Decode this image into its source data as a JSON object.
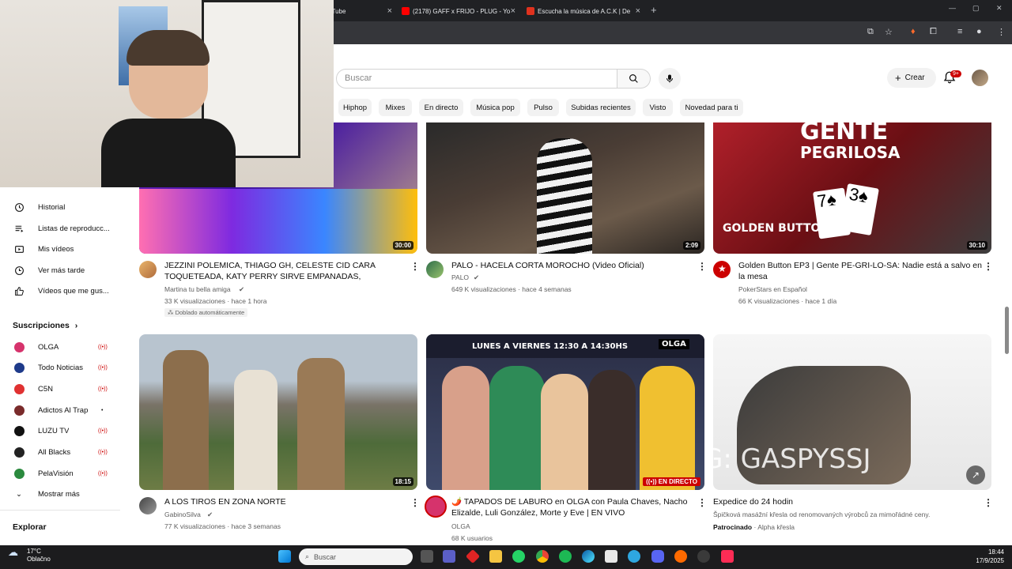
{
  "browser": {
    "tabs": [
      {
        "title": "YouTube"
      },
      {
        "title": "(2178) GAFF x FRIJO - PLUG - Yo"
      },
      {
        "title": "Escucha la música de A.C.K | De"
      }
    ]
  },
  "header": {
    "search_placeholder": "Buscar",
    "create_label": "Crear",
    "notification_count": "9+"
  },
  "chips": [
    "Hiphop",
    "Mixes",
    "En directo",
    "Música pop",
    "Pulso",
    "Subidas recientes",
    "Visto",
    "Novedad para ti"
  ],
  "sidebar": {
    "you_items": [
      {
        "label": "Historial",
        "icon": "history-icon"
      },
      {
        "label": "Listas de reproducc...",
        "icon": "playlists-icon"
      },
      {
        "label": "Mis vídeos",
        "icon": "my-videos-icon"
      },
      {
        "label": "Ver más tarde",
        "icon": "watch-later-icon"
      },
      {
        "label": "Vídeos que me gus...",
        "icon": "liked-icon"
      }
    ],
    "subscriptions_title": "Suscripciones",
    "subscriptions": [
      {
        "label": "OLGA",
        "color": "#d6336c"
      },
      {
        "label": "Todo Noticias",
        "color": "#1e3a8a"
      },
      {
        "label": "C5N",
        "color": "#e03131"
      },
      {
        "label": "Adictos Al Trap",
        "color": "#7a2b2b"
      },
      {
        "label": "LUZU TV",
        "color": "#111111"
      },
      {
        "label": "All Blacks",
        "color": "#222222"
      },
      {
        "label": "PelaVisión",
        "color": "#2b8a3e"
      }
    ],
    "show_more": "Mostrar más",
    "explore_title": "Explorar"
  },
  "videos": [
    {
      "title": "JEZZINI POLEMICA, THIAGO GH, CELESTE CID CARA TOQUETEADA, KATY PERRY SIRVE EMPANADAS, TAYLOR ...",
      "channel": "Martina tu bella amiga",
      "meta": "33 K visualizaciones · hace 1 hora",
      "extra": "Doblado automáticamente",
      "duration": "30:00"
    },
    {
      "title": "PALO - HACELA CORTA MOROCHO (Video Oficial)",
      "channel": "PALO",
      "meta": "649 K visualizaciones · hace 4 semanas",
      "duration": "2:09"
    },
    {
      "title": "Golden Button EP3 | Gente PE-GRI-LO-SA: Nadie está a salvo en la mesa",
      "channel": "PokerStars en Español",
      "meta": "66 K visualizaciones · hace 1 día",
      "duration": "30:10",
      "thumb_text_top": "GENTE",
      "thumb_text_mid": "PEGRILOSA",
      "thumb_text_logo": "GOLDEN BUTTON"
    },
    {
      "title": "A LOS TIROS EN ZONA NORTE",
      "channel": "GabinoSilva",
      "meta": "77 K visualizaciones · hace 3 semanas",
      "duration": "18:15"
    },
    {
      "title": "🌶️ TAPADOS DE LABURO en OLGA con Paula Chaves, Nacho Elizalde, Luli González, Morte y Eve | EN VIVO",
      "channel": "OLGA",
      "meta": "68 K usuarios",
      "live": "EN DIRECTO",
      "thumb_banner": "LUNES A VIERNES 12:30 A 14:30HS",
      "thumb_brand": "OLGA"
    },
    {
      "title": "Expedice do 24 hodin",
      "channel": "",
      "meta": "Špičková masážní křesla od renomovaných výrobců za mimořádné ceny.",
      "sponsored": "Patrocinado",
      "sponsor_name": "· Alpha křesla",
      "overlay_text": "IG: GASPYSSJ"
    }
  ],
  "taskbar": {
    "weather_temp": "17°C",
    "weather_desc": "Oblačno",
    "search_placeholder": "Buscar",
    "time": "18:44",
    "date": "17/9/2025"
  }
}
